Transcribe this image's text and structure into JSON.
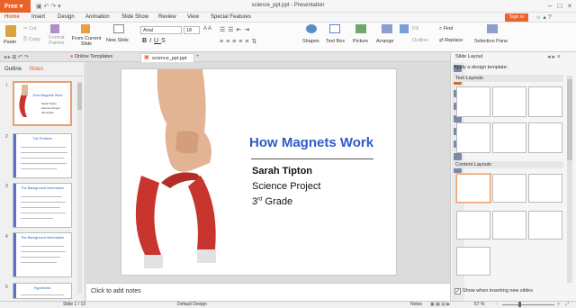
{
  "titlebar": {
    "app_button": "Free",
    "title": "science_ppt.ppt - Presentation"
  },
  "menu": {
    "items": [
      "Home",
      "Insert",
      "Design",
      "Animation",
      "Slide Show",
      "Review",
      "View",
      "Special Features"
    ],
    "signin": "Sign in"
  },
  "ribbon": {
    "paste": "Paste",
    "cut": "Cut",
    "copy": "Copy",
    "format_painter": "Format Painter",
    "from_current_slide": "From Current Slide",
    "new_slide": "New Slide",
    "font_name": "Arial",
    "font_size": "18",
    "shapes": "Shapes",
    "text_box": "Text Box",
    "picture": "Picture",
    "arrange": "Arrange",
    "fill": "Fill",
    "outline": "Outline",
    "find": "Find",
    "replace": "Replace",
    "selection_pane": "Selection Pane"
  },
  "tabs": {
    "online_templates": "Online Templates",
    "doc": "science_ppt.ppt"
  },
  "panel_tabs": {
    "outline": "Outline",
    "slides": "Slides"
  },
  "thumbnails": [
    {
      "num": "1",
      "title": "How Magnets Work",
      "lines": [
        "Sarah Tipton",
        "Science Project",
        "3rd Grade"
      ]
    },
    {
      "num": "2",
      "title": "The Problem",
      "lines": [
        "",
        "",
        "",
        "",
        ""
      ]
    },
    {
      "num": "3",
      "title": "The Background Information",
      "lines": [
        "",
        "",
        "",
        "",
        ""
      ]
    },
    {
      "num": "4",
      "title": "The Background Information",
      "lines": [
        "",
        "",
        "",
        ""
      ]
    },
    {
      "num": "5",
      "title": "Hypothesis",
      "lines": [
        ""
      ]
    }
  ],
  "slide": {
    "title": "How Magnets Work",
    "author": "Sarah Tipton",
    "subtitle": "Science Project",
    "grade_num": "3",
    "grade_sup": "rd",
    "grade_rest": " Grade"
  },
  "notes": "Click to add notes",
  "right_panel": {
    "header": "Slide Layout",
    "apply": "Apply a design template:",
    "text_layouts": "Text Layouts",
    "content_layouts": "Content Layouts",
    "show_when": "Show when inserting new slides"
  },
  "status": {
    "slide_of": "Slide 1 / 13",
    "design": "Default Design",
    "notes_btn": "Notes",
    "zoom": "67 %"
  },
  "colors": {
    "accent": "#e8642b",
    "title_blue": "#2f5cc7"
  }
}
